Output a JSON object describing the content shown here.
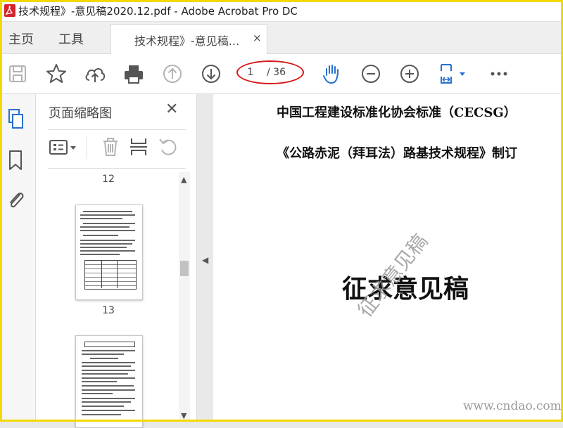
{
  "window": {
    "title": "技术规程》-意见稿2020.12.pdf - Adobe Acrobat Pro DC"
  },
  "tabs": {
    "home": "主页",
    "tools": "工具",
    "document": "技术规程》-意见稿...",
    "close_glyph": "×"
  },
  "toolbar": {
    "icons": [
      "save-icon",
      "bookmark-star-icon",
      "upload-cloud-icon",
      "print-icon",
      "previous-page-icon",
      "next-page-icon",
      "hand-tool-icon",
      "zoom-out-icon",
      "zoom-in-icon",
      "page-fit-icon",
      "more-icon"
    ],
    "page_current": "1",
    "page_total": "/ 36",
    "highlight_color": "#d81818"
  },
  "left_rail": {
    "icons": [
      "page-thumbnails-icon",
      "bookmarks-icon",
      "attachments-icon"
    ],
    "accent": "#2a6fcf"
  },
  "thumbnail_panel": {
    "title": "页面缩略图",
    "close_glyph": "✕",
    "tools": [
      "options-icon",
      "delete-icon",
      "insert-page-icon",
      "undo-icon"
    ],
    "pages": [
      {
        "number": "12"
      },
      {
        "number": "13"
      }
    ]
  },
  "scrollbar": {
    "up": "▲",
    "down": "▼"
  },
  "collapse": {
    "glyph": "◀"
  },
  "document": {
    "line1": "中国工程建设标准化协会标准（CECSG）",
    "line2": "《公路赤泥（拜耳法）路基技术规程》制订",
    "heading": "征求意见稿",
    "watermark": "征求意见稿",
    "site_watermark": "www.cndao.com"
  }
}
